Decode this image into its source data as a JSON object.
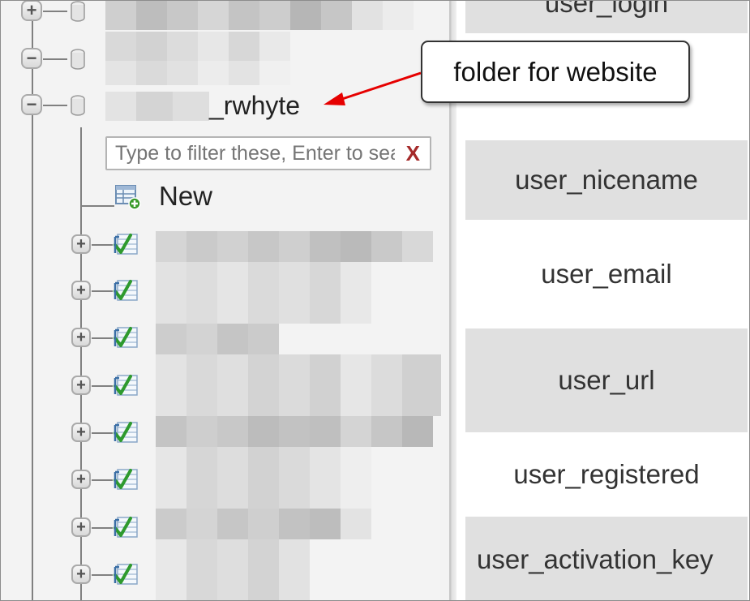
{
  "nav": {
    "databases": [
      {
        "state": "collapsed",
        "label_suffix": ""
      },
      {
        "state": "expanded",
        "label_suffix": ""
      },
      {
        "state": "expanded",
        "label_suffix": "_rwhyte"
      }
    ],
    "filter": {
      "placeholder": "Type to filter these, Enter to search all",
      "value": "",
      "clear_label": "X"
    },
    "new_label": "New",
    "table_count": 8
  },
  "columns": {
    "items": [
      {
        "label": "user_login"
      },
      {
        "label": "user_nicename"
      },
      {
        "label": "user_email"
      },
      {
        "label": "user_url"
      },
      {
        "label": "user_registered"
      },
      {
        "label": "user_activation_key"
      }
    ]
  },
  "annotation": {
    "callout_text": "folder for website",
    "arrow_color": "#e60000"
  },
  "colors": {
    "accent_add": "#3a9a2a",
    "filter_clear": "#a52a2a",
    "row_shade": "#e0e0e0"
  }
}
